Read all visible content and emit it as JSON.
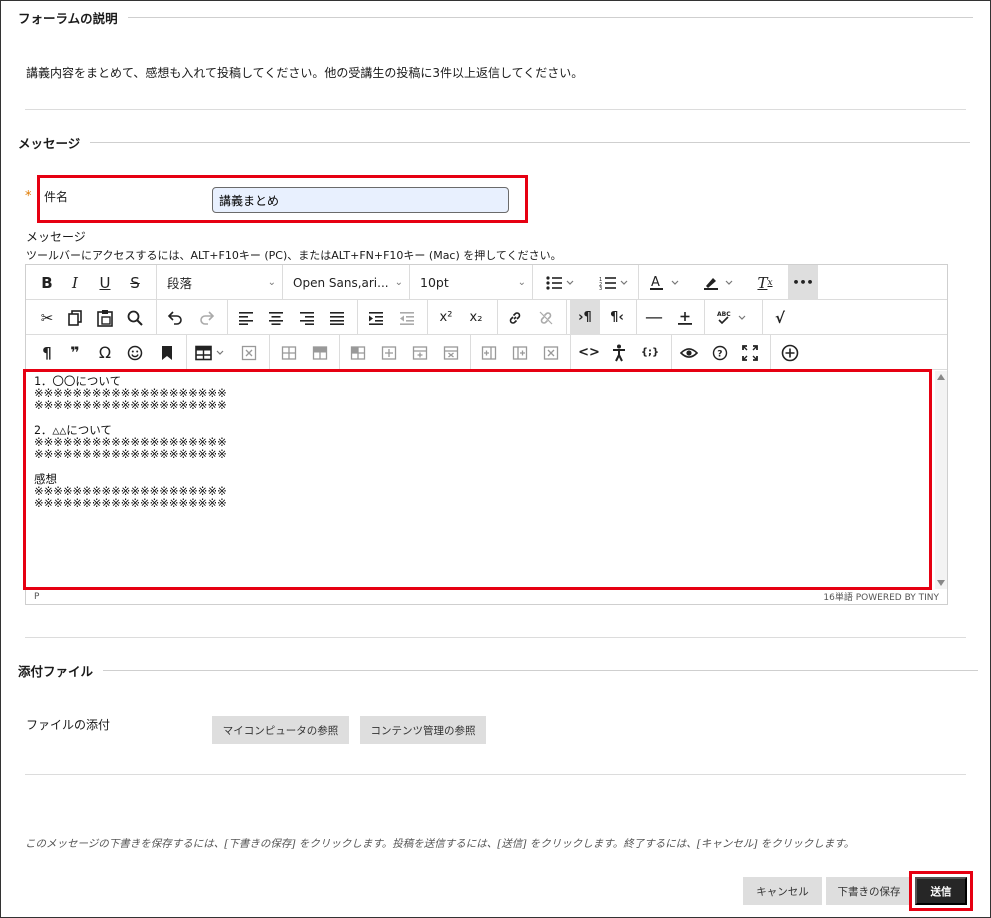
{
  "forum_description": {
    "legend": "フォーラムの説明",
    "text": "講義内容をまとめて、感想も入れて投稿してください。他の受講生の投稿に3件以上返信してください。"
  },
  "message_section": {
    "legend": "メッセージ",
    "required_mark": "*",
    "subject_label": "件名",
    "subject_value": "講義まとめ",
    "message_label": "メッセージ",
    "toolbar_hint": "ツールバーにアクセスするには、ALT+F10キー (PC)、またはALT+FN+F10キー (Mac) を押してください。"
  },
  "editor": {
    "toolbar": {
      "bold": "B",
      "italic": "I",
      "underline": "U",
      "strike": "S",
      "block_format": "段落",
      "font_family": "Open Sans,ari...",
      "font_size": "10pt",
      "more": "•••",
      "pilcrow": "¶",
      "quote": "❞",
      "omega": "Ω",
      "superscript": "x²",
      "subscript": "x₂",
      "code": "<>",
      "template": "{;}"
    },
    "content_lines": [
      "1．〇〇について",
      "※※※※※※※※※※※※※※※※※※※※",
      "※※※※※※※※※※※※※※※※※※※※",
      "",
      "2．△△について",
      "※※※※※※※※※※※※※※※※※※※※",
      "※※※※※※※※※※※※※※※※※※※※",
      "",
      "感想",
      "※※※※※※※※※※※※※※※※※※※※",
      "※※※※※※※※※※※※※※※※※※※※"
    ],
    "status_path": "P",
    "status_right": "16単語  POWERED BY TINY"
  },
  "attachment_section": {
    "legend": "添付ファイル",
    "label": "ファイルの添付",
    "browse_computer": "マイコンピュータの参照",
    "browse_content": "コンテンツ管理の参照"
  },
  "footer": {
    "instructions": "このメッセージの下書きを保存するには、[下書きの保存] をクリックします。投稿を送信するには、[送信] をクリックします。終了するには、[キャンセル] をクリックします。",
    "cancel": "キャンセル",
    "save_draft": "下書きの保存",
    "submit": "送信"
  },
  "colors": {
    "highlight_box": "#e60012",
    "submit_bg": "#262626",
    "secondary_btn_bg": "#dedede",
    "input_bg": "#e8f0fe"
  }
}
